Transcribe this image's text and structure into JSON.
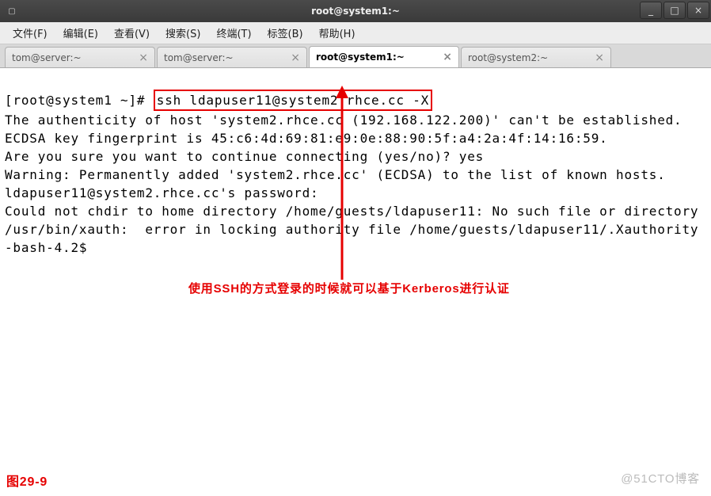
{
  "window": {
    "title": "root@system1:~"
  },
  "menu": {
    "file": "文件(F)",
    "edit": "编辑(E)",
    "view": "查看(V)",
    "search": "搜索(S)",
    "terminal": "终端(T)",
    "tabs": "标签(B)",
    "help": "帮助(H)"
  },
  "tabs": [
    {
      "label": "tom@server:~",
      "active": false
    },
    {
      "label": "tom@server:~",
      "active": false
    },
    {
      "label": "root@system1:~",
      "active": true
    },
    {
      "label": "root@system2:~",
      "active": false
    }
  ],
  "terminal": {
    "prompt": "[root@system1 ~]# ",
    "command": "ssh ldapuser11@system2.rhce.cc -X",
    "lines": [
      "The authenticity of host 'system2.rhce.cc (192.168.122.200)' can't be established.",
      "ECDSA key fingerprint is 45:c6:4d:69:81:e9:0e:88:90:5f:a4:2a:4f:14:16:59.",
      "Are you sure you want to continue connecting (yes/no)? yes",
      "Warning: Permanently added 'system2.rhce.cc' (ECDSA) to the list of known hosts.",
      "ldapuser11@system2.rhce.cc's password:",
      "Could not chdir to home directory /home/guests/ldapuser11: No such file or directory",
      "/usr/bin/xauth:  error in locking authority file /home/guests/ldapuser11/.Xauthority",
      "-bash-4.2$"
    ]
  },
  "annotation": "使用SSH的方式登录的时候就可以基于Kerberos进行认证",
  "figure_label": "图29-9",
  "watermark": "@51CTO博客"
}
